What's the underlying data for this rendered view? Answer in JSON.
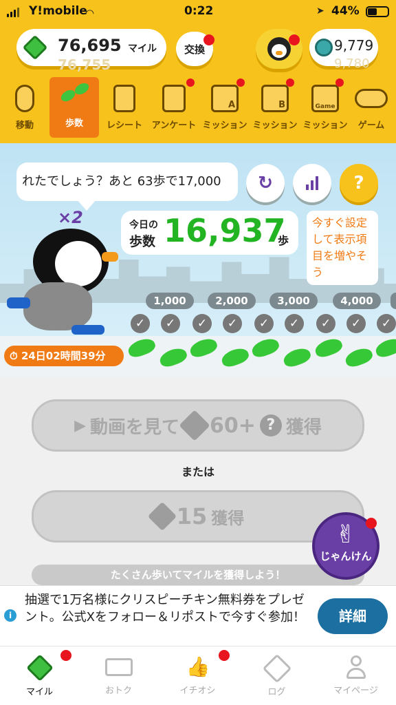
{
  "status_bar": {
    "carrier": "Y!mobile",
    "time": "0:22",
    "battery": "44%"
  },
  "header": {
    "miles": "76,695",
    "miles_unit": "マイル",
    "miles_ghost": "76,755",
    "exchange_label": "交換",
    "coins": "9,779",
    "coins_ghost": "9,780"
  },
  "tabs": [
    {
      "label": "移動"
    },
    {
      "label": "歩数"
    },
    {
      "label": "レシート"
    },
    {
      "label": "アンケート"
    },
    {
      "label": "ミッション"
    },
    {
      "label": "ミッション"
    },
    {
      "label": "ミッション"
    },
    {
      "label": "ゲーム"
    }
  ],
  "tab_marks": {
    "a": "A",
    "b": "B",
    "game": "Game"
  },
  "steps": {
    "speech": "れたでしょう？あと 63歩で17,000",
    "multiplier": "×2",
    "today_label_1": "今日の",
    "today_label_2": "歩数",
    "count": "16,937",
    "unit": "歩",
    "tip": "今すぐ設定して表示項目を増やそう",
    "help_icon": "?",
    "timer": "24日02時間39分",
    "milestones": [
      "1,000",
      "2,000",
      "3,000",
      "4,000"
    ]
  },
  "actions": {
    "video_prefix": "動画を見て",
    "video_amount": "60+",
    "video_suffix": "獲得",
    "or": "または",
    "claim_amount": "15",
    "claim_suffix": "獲得",
    "janken": "じゃんけん",
    "banner": "たくさん歩いてマイルを獲得しよう！"
  },
  "ad": {
    "text": "抽選で1万名様にクリスピーチキン無料券をプレゼント。公式Xをフォロー＆リポストで今すぐ参加！",
    "button": "詳細"
  },
  "bottom_nav": [
    {
      "label": "マイル"
    },
    {
      "label": "おトク"
    },
    {
      "label": "イチオシ"
    },
    {
      "label": "ログ"
    },
    {
      "label": "マイページ"
    }
  ],
  "colors": {
    "brand_yellow": "#f8c21c",
    "active_tab": "#f07a13",
    "step_green": "#22b422",
    "tip_orange": "#f07a13",
    "janken_purple": "#6a3fa5",
    "ad_button": "#1b6fa1"
  }
}
